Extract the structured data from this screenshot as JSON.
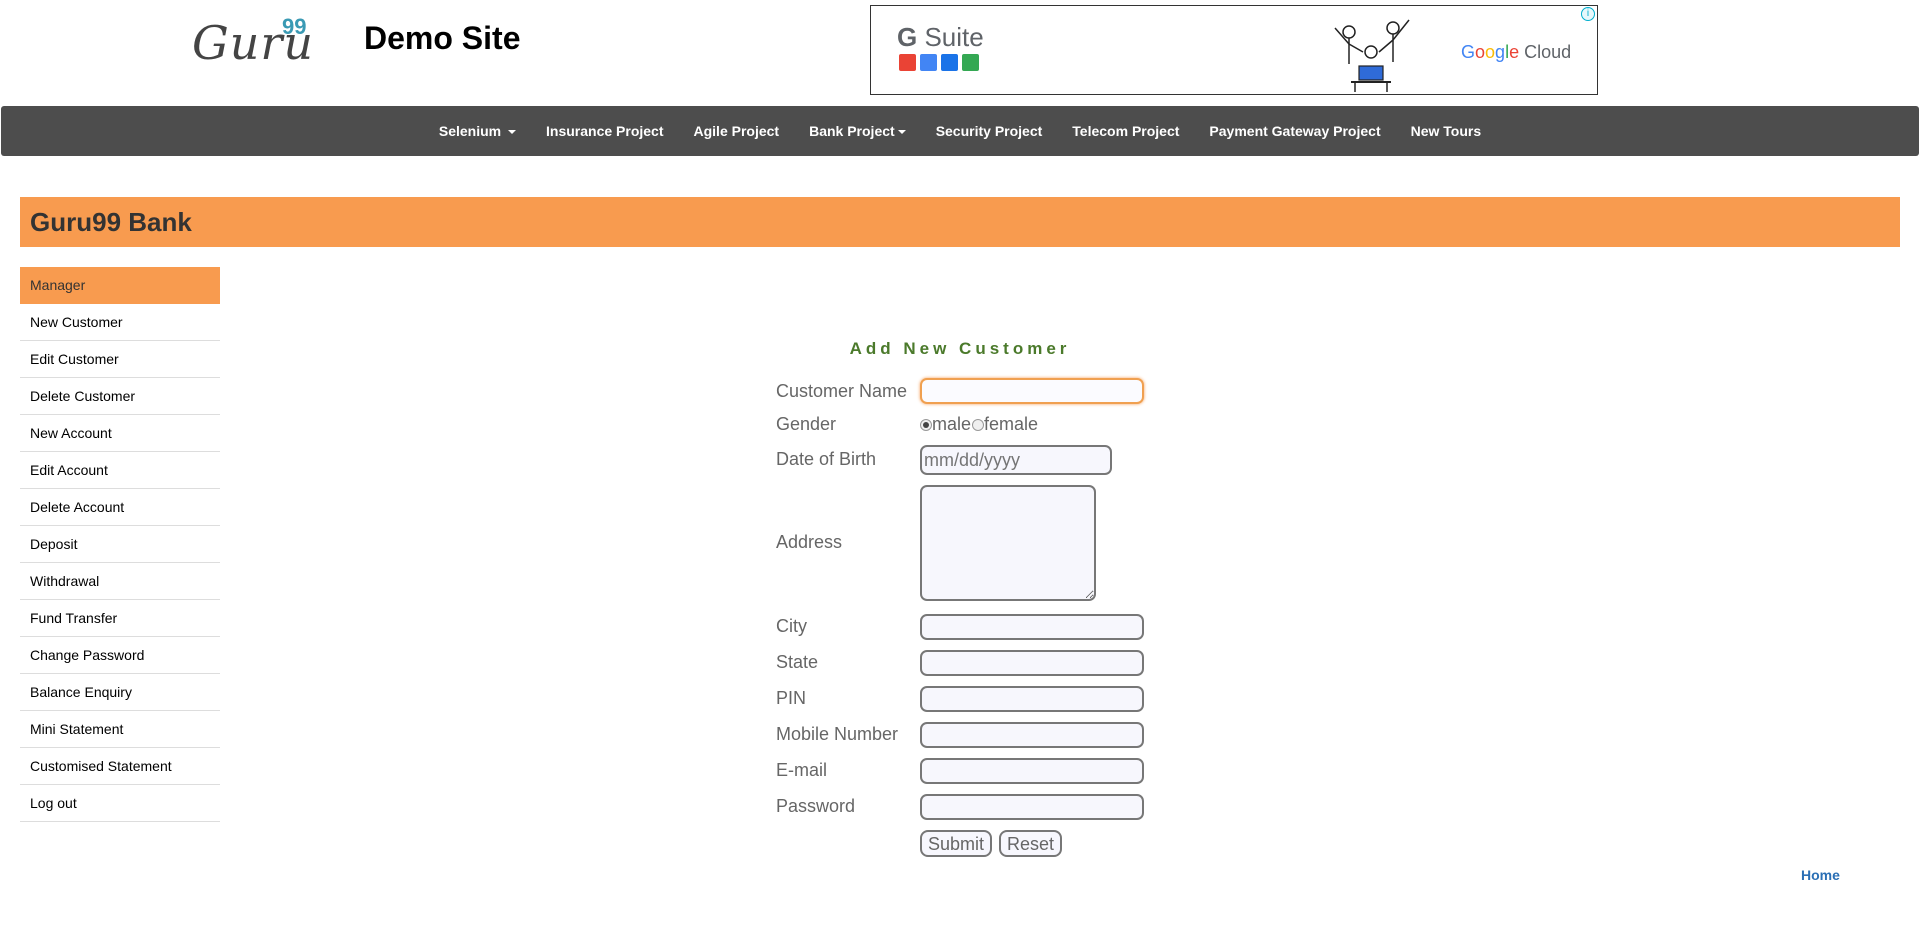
{
  "header": {
    "logo_text": "Guru",
    "logo_sup": "99",
    "site_title": "Demo Site"
  },
  "ad": {
    "product": "Suite",
    "product_g": "G",
    "cloud_words": [
      "G",
      "o",
      "o",
      "g",
      "l",
      "e",
      " Cloud"
    ],
    "info_glyph": "i",
    "icon_colors": [
      "#ea4335",
      "#4285f4",
      "#1a73e8",
      "#34a853"
    ]
  },
  "nav": {
    "items": [
      {
        "label": "Selenium",
        "dropdown": true
      },
      {
        "label": "Insurance Project",
        "dropdown": false
      },
      {
        "label": "Agile Project",
        "dropdown": false
      },
      {
        "label": "Bank Project",
        "dropdown": true
      },
      {
        "label": "Security Project",
        "dropdown": false
      },
      {
        "label": "Telecom Project",
        "dropdown": false
      },
      {
        "label": "Payment Gateway Project",
        "dropdown": false
      },
      {
        "label": "New Tours",
        "dropdown": false
      }
    ]
  },
  "bank": {
    "title": "Guru99 Bank"
  },
  "sidebar": {
    "items": [
      {
        "label": "Manager",
        "active": true
      },
      {
        "label": "New Customer"
      },
      {
        "label": "Edit Customer"
      },
      {
        "label": "Delete Customer"
      },
      {
        "label": "New Account"
      },
      {
        "label": "Edit Account"
      },
      {
        "label": "Delete Account"
      },
      {
        "label": "Deposit"
      },
      {
        "label": "Withdrawal"
      },
      {
        "label": "Fund Transfer"
      },
      {
        "label": "Change Password"
      },
      {
        "label": "Balance Enquiry"
      },
      {
        "label": "Mini Statement"
      },
      {
        "label": "Customised Statement"
      },
      {
        "label": "Log out"
      }
    ]
  },
  "form": {
    "title": "Add New Customer",
    "labels": {
      "customer_name": "Customer Name",
      "gender": "Gender",
      "dob": "Date of Birth",
      "address": "Address",
      "city": "City",
      "state": "State",
      "pin": "PIN",
      "mobile": "Mobile Number",
      "email": "E-mail",
      "password": "Password"
    },
    "gender_options": {
      "male": "male",
      "female": "female",
      "selected": "male"
    },
    "dob_placeholder": "mm/dd/yyyy",
    "submit_label": "Submit",
    "reset_label": "Reset"
  },
  "footer": {
    "home_link": "Home"
  },
  "colors": {
    "accent_orange": "#f89b4f",
    "navbar_bg": "#4d4d4d",
    "form_title_green": "#4b7a2b",
    "link_blue": "#2a6fb5"
  }
}
